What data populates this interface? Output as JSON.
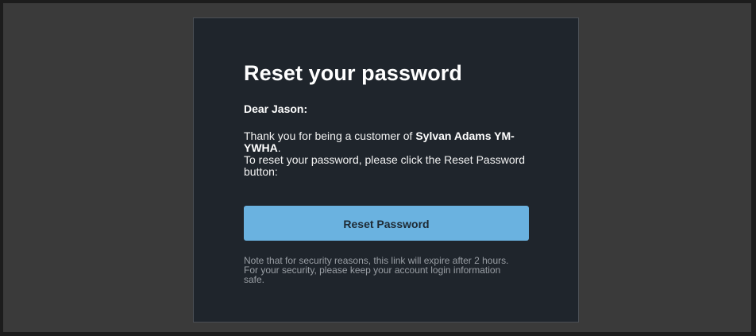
{
  "email": {
    "title": "Reset your password",
    "greeting": "Dear Jason:",
    "intro_prefix": "Thank you for being a customer of ",
    "organization": "Sylvan Adams YM-YWHA",
    "intro_suffix": ".",
    "instruction": "To reset your password, please click the Reset Password button:",
    "button_label": "Reset Password",
    "note_line1": "Note that for security reasons, this link will expire after 2 hours.",
    "note_line2": "For your security, please keep your account login information safe."
  },
  "colors": {
    "background": "#3a3a3a",
    "card": "#1f252c",
    "button": "#6ab2e0"
  }
}
